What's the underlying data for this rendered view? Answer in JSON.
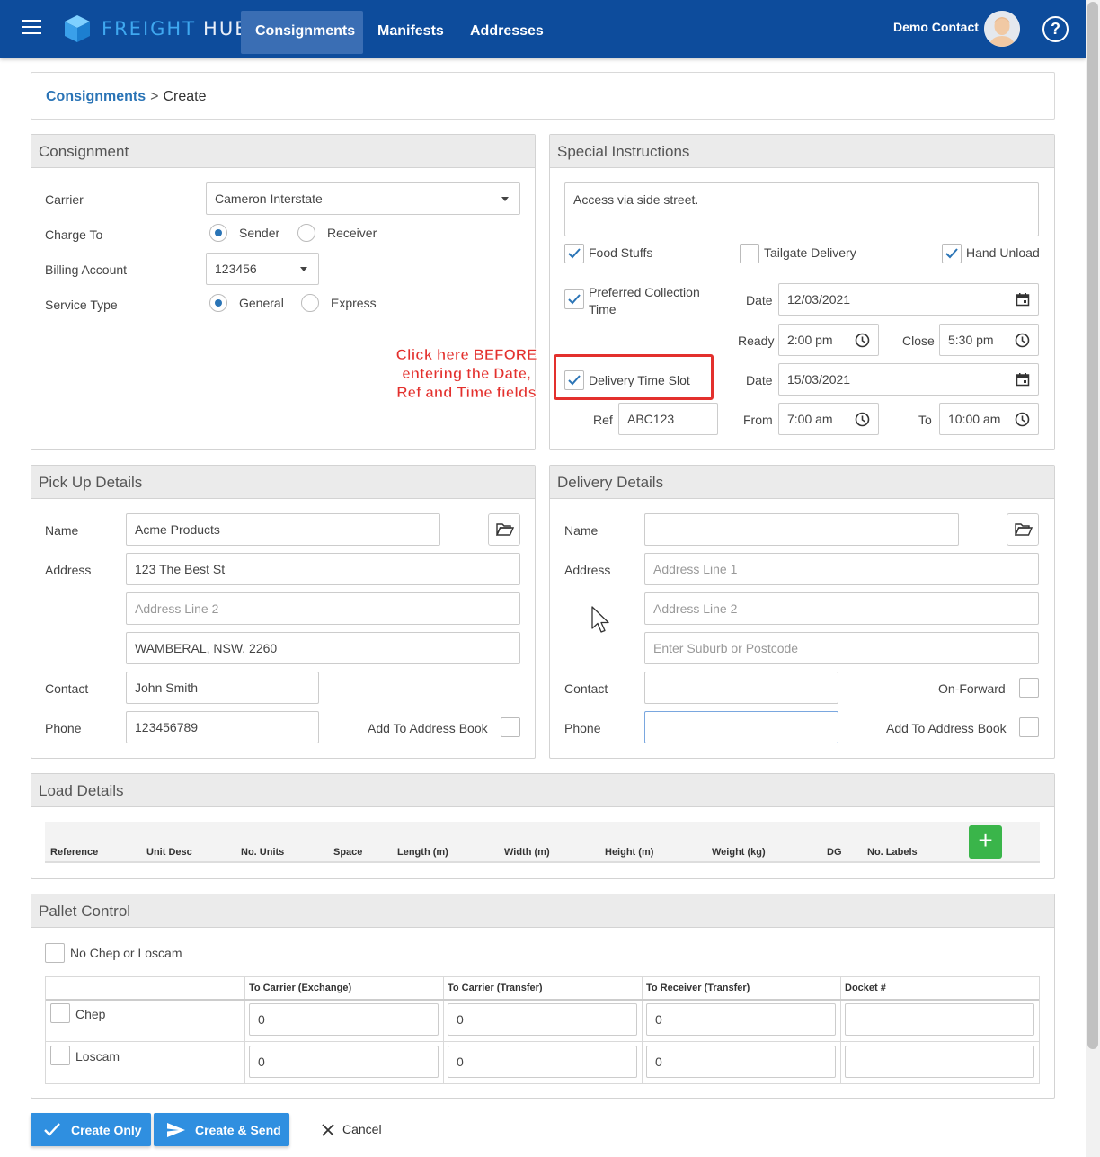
{
  "app": {
    "logo_primary": "FREIGHT",
    "logo_secondary": "HUB",
    "nav": [
      "Consignments",
      "Manifests",
      "Addresses"
    ],
    "user": "Demo Contact",
    "help": "?"
  },
  "breadcrumb": {
    "parent": "Consignments",
    "separator": ">",
    "current": "Create"
  },
  "consignment": {
    "title": "Consignment",
    "carrier_label": "Carrier",
    "carrier_value": "Cameron Interstate",
    "charge_to_label": "Charge To",
    "charge_to_options": [
      "Sender",
      "Receiver"
    ],
    "billing_label": "Billing Account",
    "billing_value": "123456",
    "service_label": "Service Type",
    "service_options": [
      "General",
      "Express"
    ]
  },
  "annotation": {
    "lines": [
      "Click here BEFORE",
      "entering the Date,",
      "Ref and Time fields"
    ]
  },
  "special": {
    "title": "Special Instructions",
    "instructions": "Access via side street.",
    "food_stuffs": "Food Stuffs",
    "tailgate": "Tailgate Delivery",
    "hand_unload": "Hand Unload",
    "preferred_line1": "Preferred Collection",
    "preferred_line2": "Time",
    "date_label": "Date",
    "collection_date": "12/03/2021",
    "ready_label": "Ready",
    "ready_value": "2:00 pm",
    "close_label": "Close",
    "close_value": "5:30 pm",
    "delivery_slot": "Delivery Time Slot",
    "delivery_date": "15/03/2021",
    "ref_label": "Ref",
    "ref_value": "ABC123",
    "from_label": "From",
    "from_value": "7:00 am",
    "to_label": "To",
    "to_value": "10:00 am"
  },
  "pickup": {
    "title": "Pick Up Details",
    "name_label": "Name",
    "name_value": "Acme Products",
    "address_label": "Address",
    "address1": "123 The Best St",
    "address2_placeholder": "Address Line 2",
    "suburb": "WAMBERAL, NSW, 2260",
    "contact_label": "Contact",
    "contact_value": "John Smith",
    "phone_label": "Phone",
    "phone_value": "123456789",
    "add_book": "Add To Address Book"
  },
  "delivery": {
    "title": "Delivery Details",
    "name_label": "Name",
    "address_label": "Address",
    "address1_placeholder": "Address Line 1",
    "address2_placeholder": "Address Line 2",
    "suburb_placeholder": "Enter Suburb or Postcode",
    "contact_label": "Contact",
    "on_forward": "On-Forward",
    "phone_label": "Phone",
    "add_book": "Add To Address Book"
  },
  "load": {
    "title": "Load Details",
    "columns": [
      "Reference",
      "Unit Desc",
      "No. Units",
      "Space",
      "Length (m)",
      "Width (m)",
      "Height (m)",
      "Weight (kg)",
      "DG",
      "No. Labels"
    ],
    "add": "+"
  },
  "pallet": {
    "title": "Pallet Control",
    "no_chep": "No Chep or Loscam",
    "columns": [
      "To Carrier (Exchange)",
      "To Carrier (Transfer)",
      "To Receiver (Transfer)",
      "Docket #"
    ],
    "rows": [
      {
        "name": "Chep",
        "values": [
          "0",
          "0",
          "0",
          ""
        ]
      },
      {
        "name": "Loscam",
        "values": [
          "0",
          "0",
          "0",
          ""
        ]
      }
    ]
  },
  "actions": {
    "create_only": "Create Only",
    "create_send": "Create & Send",
    "cancel": "Cancel"
  },
  "colors": {
    "topbar": "#0d4c9c",
    "accent": "#2f8fe0",
    "annotation": "#e3302d",
    "add": "#3ab54a"
  }
}
